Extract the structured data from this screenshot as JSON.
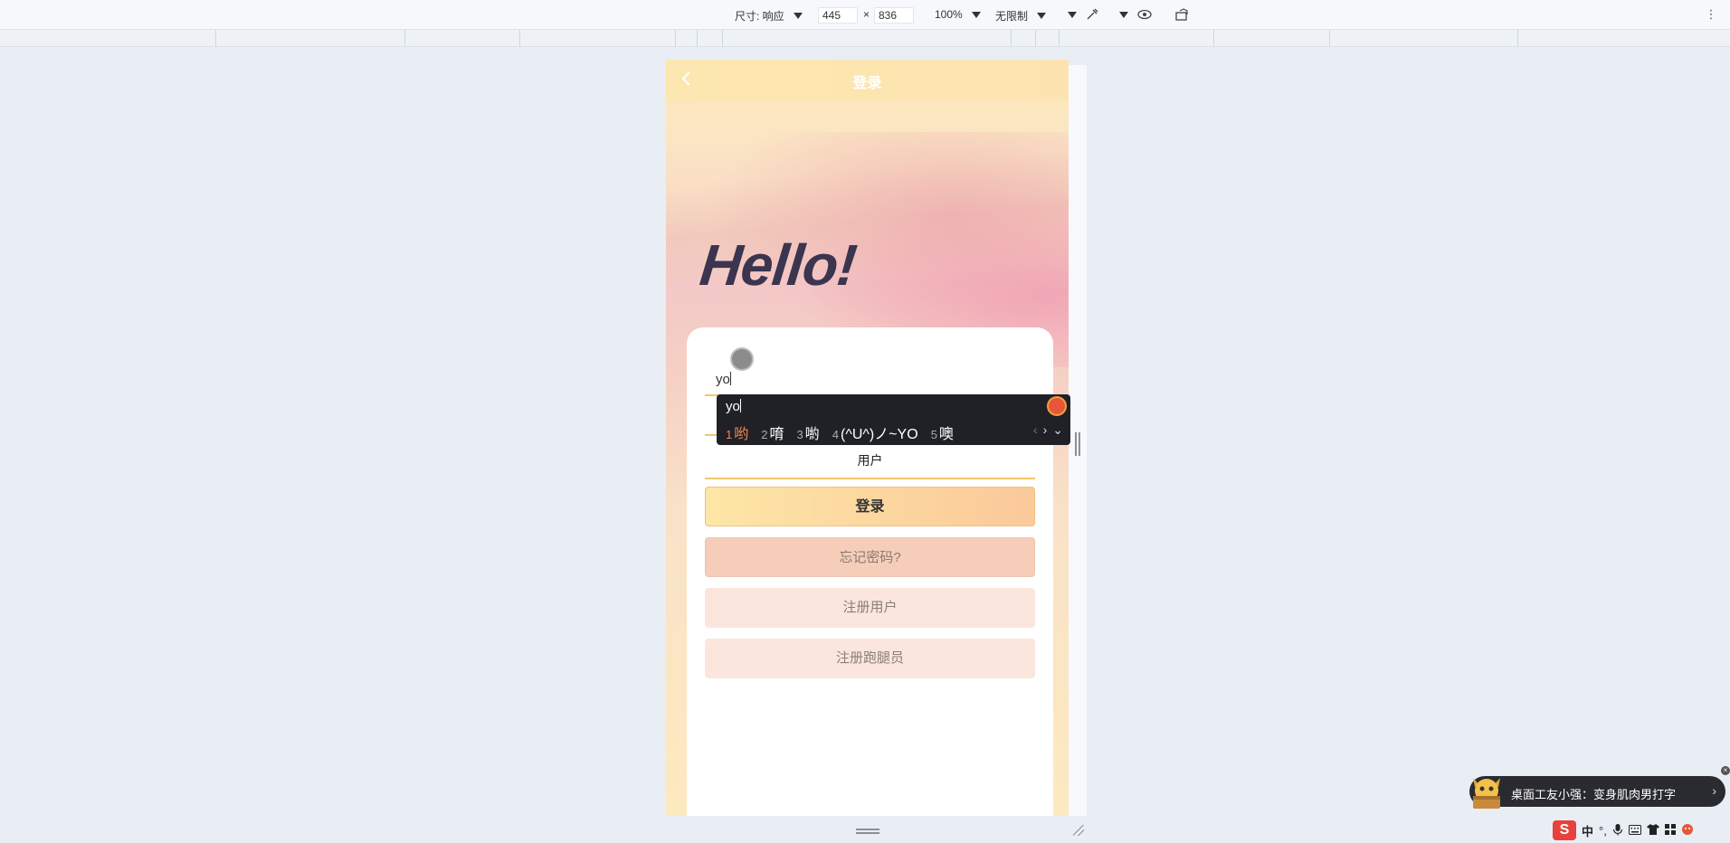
{
  "toolbar": {
    "size_label": "尺寸: 响应",
    "width_value": "445",
    "times": "×",
    "height_value": "836",
    "zoom": "100%",
    "throttle": "无限制"
  },
  "page": {
    "nav_title": "登录",
    "hello": "Hello!",
    "username_value": "yo",
    "role_label": "用户",
    "login_button": "登录",
    "forgot_button": "忘记密码?",
    "register_user_button": "注册用户",
    "register_runner_button": "注册跑腿员"
  },
  "ime": {
    "input": "yo",
    "candidates": [
      {
        "num": "1",
        "text": "哟"
      },
      {
        "num": "2",
        "text": "唷"
      },
      {
        "num": "3",
        "text": "喲"
      },
      {
        "num": "4",
        "text": "(^U^)ノ~YO"
      },
      {
        "num": "5",
        "text": "噢"
      }
    ]
  },
  "notice": {
    "text": "桌面工友小强：变身肌肉男打字"
  },
  "ime_bar": {
    "logo": "S",
    "mode": "中",
    "punct": "°,"
  },
  "colors": {
    "accent_line": "#f2c66b",
    "title_text": "#3b3550",
    "ime_highlight": "#f0884f"
  }
}
